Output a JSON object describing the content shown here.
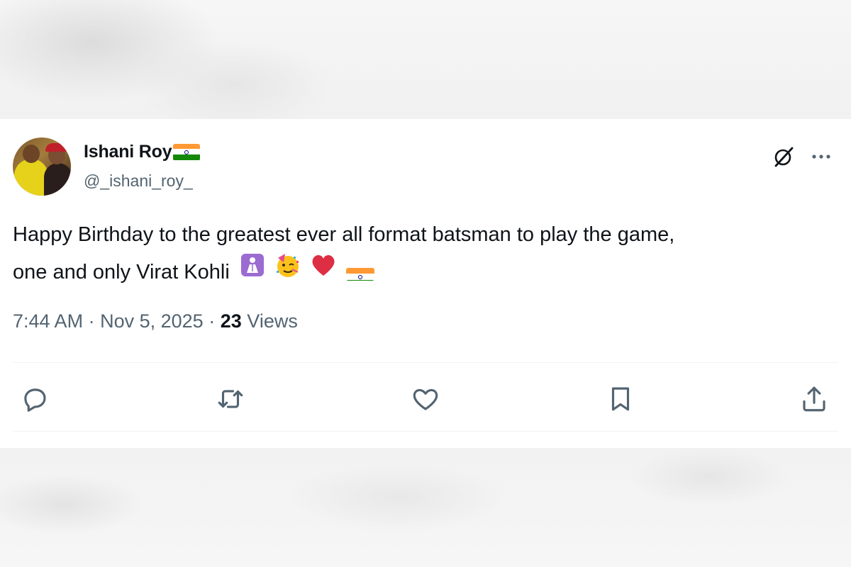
{
  "tweet": {
    "author": {
      "display_name": "Ishani Roy",
      "handle": "@_ishani_roy_",
      "name_emoji": "india-flag"
    },
    "text_line1": "Happy Birthday to the greatest ever all format batsman to play the game,",
    "text_line2": "one and only Virat Kohli",
    "text_emojis": [
      "person-in-frame-emoji",
      "partying-face-emoji",
      "red-heart-emoji",
      "india-flag-emoji"
    ],
    "time": "7:44 AM",
    "separator": "·",
    "date": "Nov 5, 2025",
    "views_count": "23",
    "views_label": "Views"
  },
  "header_icons": [
    "grok-icon",
    "more-icon"
  ],
  "actions": [
    "reply-icon",
    "retweet-icon",
    "like-icon",
    "bookmark-icon",
    "share-icon"
  ],
  "colors": {
    "text_primary": "#0f1419",
    "text_secondary": "#536471",
    "divider": "#eff3f4",
    "flag_saffron": "#ff9933",
    "flag_green": "#138808",
    "heart_red": "#dd2e44"
  }
}
